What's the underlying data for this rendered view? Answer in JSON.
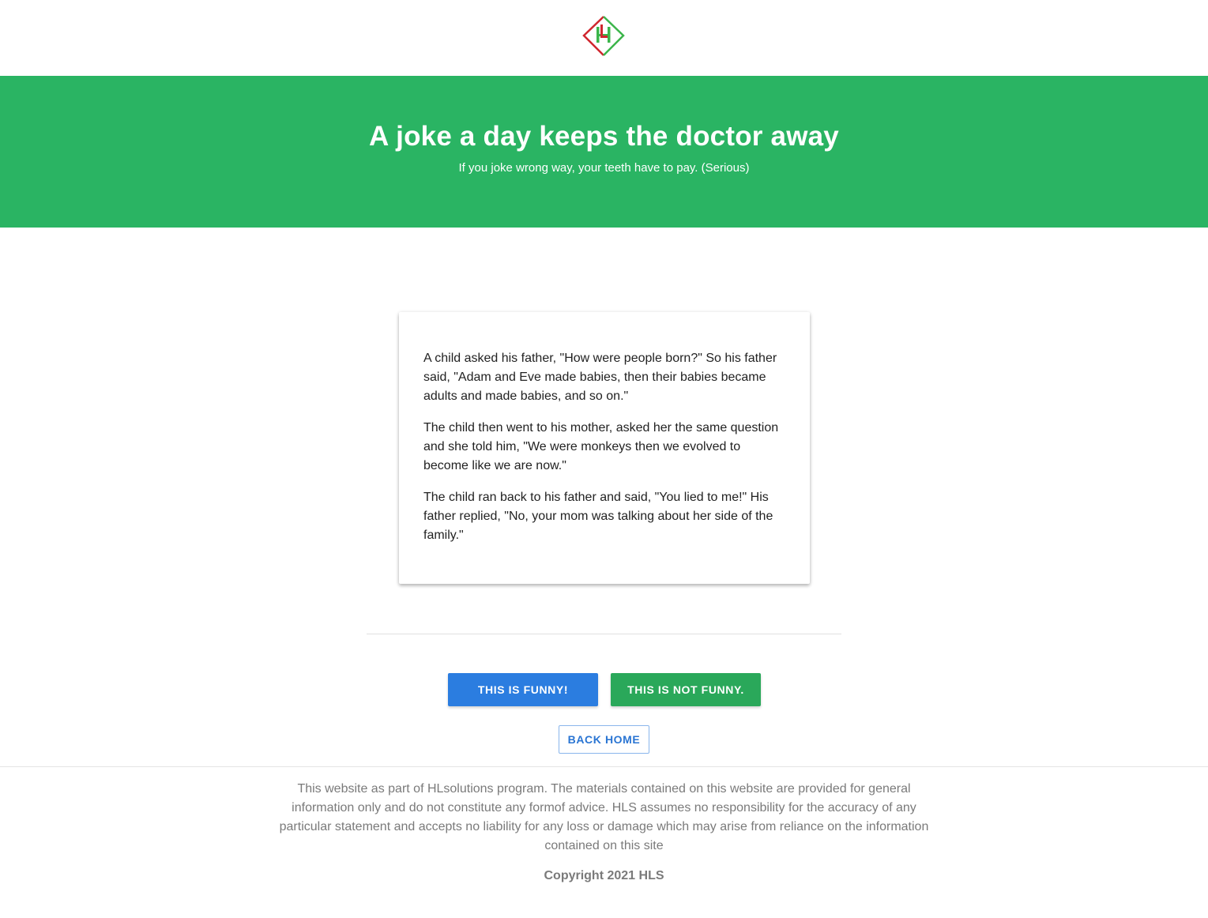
{
  "header": {
    "logo_text": "HL",
    "logo_icon": "hl-diamond-logo"
  },
  "hero": {
    "title": "A joke a day keeps the doctor away",
    "subtitle": "If you joke wrong way, your teeth have to pay. (Serious)"
  },
  "joke": {
    "paragraphs": [
      "A child asked his father, \"How were people born?\" So his father said, \"Adam and Eve made babies, then their babies became adults and made babies, and so on.\"",
      "The child then went to his mother, asked her the same question and she told him, \"We were monkeys then we evolved to become like we are now.\"",
      "The child ran back to his father and said, \"You lied to me!\" His father replied, \"No, your mom was talking about her side of the family.\""
    ]
  },
  "actions": {
    "funny_label": "THIS IS FUNNY!",
    "not_funny_label": "THIS IS NOT FUNNY.",
    "back_home_label": "BACK HOME"
  },
  "footer": {
    "disclaimer": "This website as part of HLsolutions program. The materials contained on this website are provided for general information only and do not constitute any formof advice. HLS assumes no responsibility for the accuracy of any particular statement and accepts no liability for any loss or damage which may arise from reliance on the information contained on this site",
    "copyright": "Copyright 2021 HLS"
  },
  "colors": {
    "hero_green": "#2ab463",
    "funny_blue": "#2b7de0",
    "not_funny_green": "#2aa85a",
    "logo_red": "#d0262e",
    "logo_green": "#3bb54a"
  }
}
